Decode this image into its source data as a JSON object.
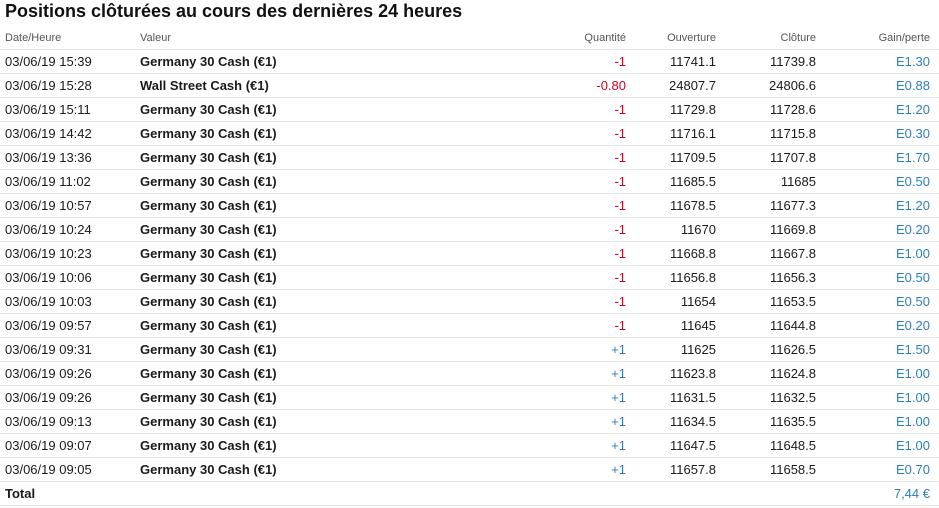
{
  "title": "Positions clôturées au cours des dernières 24 heures",
  "headers": {
    "date": "Date/Heure",
    "valeur": "Valeur",
    "quantite": "Quantité",
    "ouverture": "Ouverture",
    "cloture": "Clôture",
    "gain": "Gain/perte"
  },
  "rows": [
    {
      "date": "03/06/19 15:39",
      "valeur": "Germany 30 Cash (€1)",
      "quantite": "-1",
      "ouverture": "11741.1",
      "cloture": "11739.8",
      "gain": "E1.30"
    },
    {
      "date": "03/06/19 15:28",
      "valeur": "Wall Street Cash (€1)",
      "quantite": "-0.80",
      "ouverture": "24807.7",
      "cloture": "24806.6",
      "gain": "E0.88"
    },
    {
      "date": "03/06/19 15:11",
      "valeur": "Germany 30 Cash (€1)",
      "quantite": "-1",
      "ouverture": "11729.8",
      "cloture": "11728.6",
      "gain": "E1.20"
    },
    {
      "date": "03/06/19 14:42",
      "valeur": "Germany 30 Cash (€1)",
      "quantite": "-1",
      "ouverture": "11716.1",
      "cloture": "11715.8",
      "gain": "E0.30"
    },
    {
      "date": "03/06/19 13:36",
      "valeur": "Germany 30 Cash (€1)",
      "quantite": "-1",
      "ouverture": "11709.5",
      "cloture": "11707.8",
      "gain": "E1.70"
    },
    {
      "date": "03/06/19 11:02",
      "valeur": "Germany 30 Cash (€1)",
      "quantite": "-1",
      "ouverture": "11685.5",
      "cloture": "11685",
      "gain": "E0.50"
    },
    {
      "date": "03/06/19 10:57",
      "valeur": "Germany 30 Cash (€1)",
      "quantite": "-1",
      "ouverture": "11678.5",
      "cloture": "11677.3",
      "gain": "E1.20"
    },
    {
      "date": "03/06/19 10:24",
      "valeur": "Germany 30 Cash (€1)",
      "quantite": "-1",
      "ouverture": "11670",
      "cloture": "11669.8",
      "gain": "E0.20"
    },
    {
      "date": "03/06/19 10:23",
      "valeur": "Germany 30 Cash (€1)",
      "quantite": "-1",
      "ouverture": "11668.8",
      "cloture": "11667.8",
      "gain": "E1.00"
    },
    {
      "date": "03/06/19 10:06",
      "valeur": "Germany 30 Cash (€1)",
      "quantite": "-1",
      "ouverture": "11656.8",
      "cloture": "11656.3",
      "gain": "E0.50"
    },
    {
      "date": "03/06/19 10:03",
      "valeur": "Germany 30 Cash (€1)",
      "quantite": "-1",
      "ouverture": "11654",
      "cloture": "11653.5",
      "gain": "E0.50"
    },
    {
      "date": "03/06/19 09:57",
      "valeur": "Germany 30 Cash (€1)",
      "quantite": "-1",
      "ouverture": "11645",
      "cloture": "11644.8",
      "gain": "E0.20"
    },
    {
      "date": "03/06/19 09:31",
      "valeur": "Germany 30 Cash (€1)",
      "quantite": "+1",
      "ouverture": "11625",
      "cloture": "11626.5",
      "gain": "E1.50"
    },
    {
      "date": "03/06/19 09:26",
      "valeur": "Germany 30 Cash (€1)",
      "quantite": "+1",
      "ouverture": "11623.8",
      "cloture": "11624.8",
      "gain": "E1.00"
    },
    {
      "date": "03/06/19 09:26",
      "valeur": "Germany 30 Cash (€1)",
      "quantite": "+1",
      "ouverture": "11631.5",
      "cloture": "11632.5",
      "gain": "E1.00"
    },
    {
      "date": "03/06/19 09:13",
      "valeur": "Germany 30 Cash (€1)",
      "quantite": "+1",
      "ouverture": "11634.5",
      "cloture": "11635.5",
      "gain": "E1.00"
    },
    {
      "date": "03/06/19 09:07",
      "valeur": "Germany 30 Cash (€1)",
      "quantite": "+1",
      "ouverture": "11647.5",
      "cloture": "11648.5",
      "gain": "E1.00"
    },
    {
      "date": "03/06/19 09:05",
      "valeur": "Germany 30 Cash (€1)",
      "quantite": "+1",
      "ouverture": "11657.8",
      "cloture": "11658.5",
      "gain": "E0.70"
    }
  ],
  "total": {
    "label": "Total",
    "value": "7,44 €"
  },
  "colors": {
    "negative": "#d0021b",
    "positive": "#2a7fc1",
    "gain": "#2a7fc1"
  }
}
